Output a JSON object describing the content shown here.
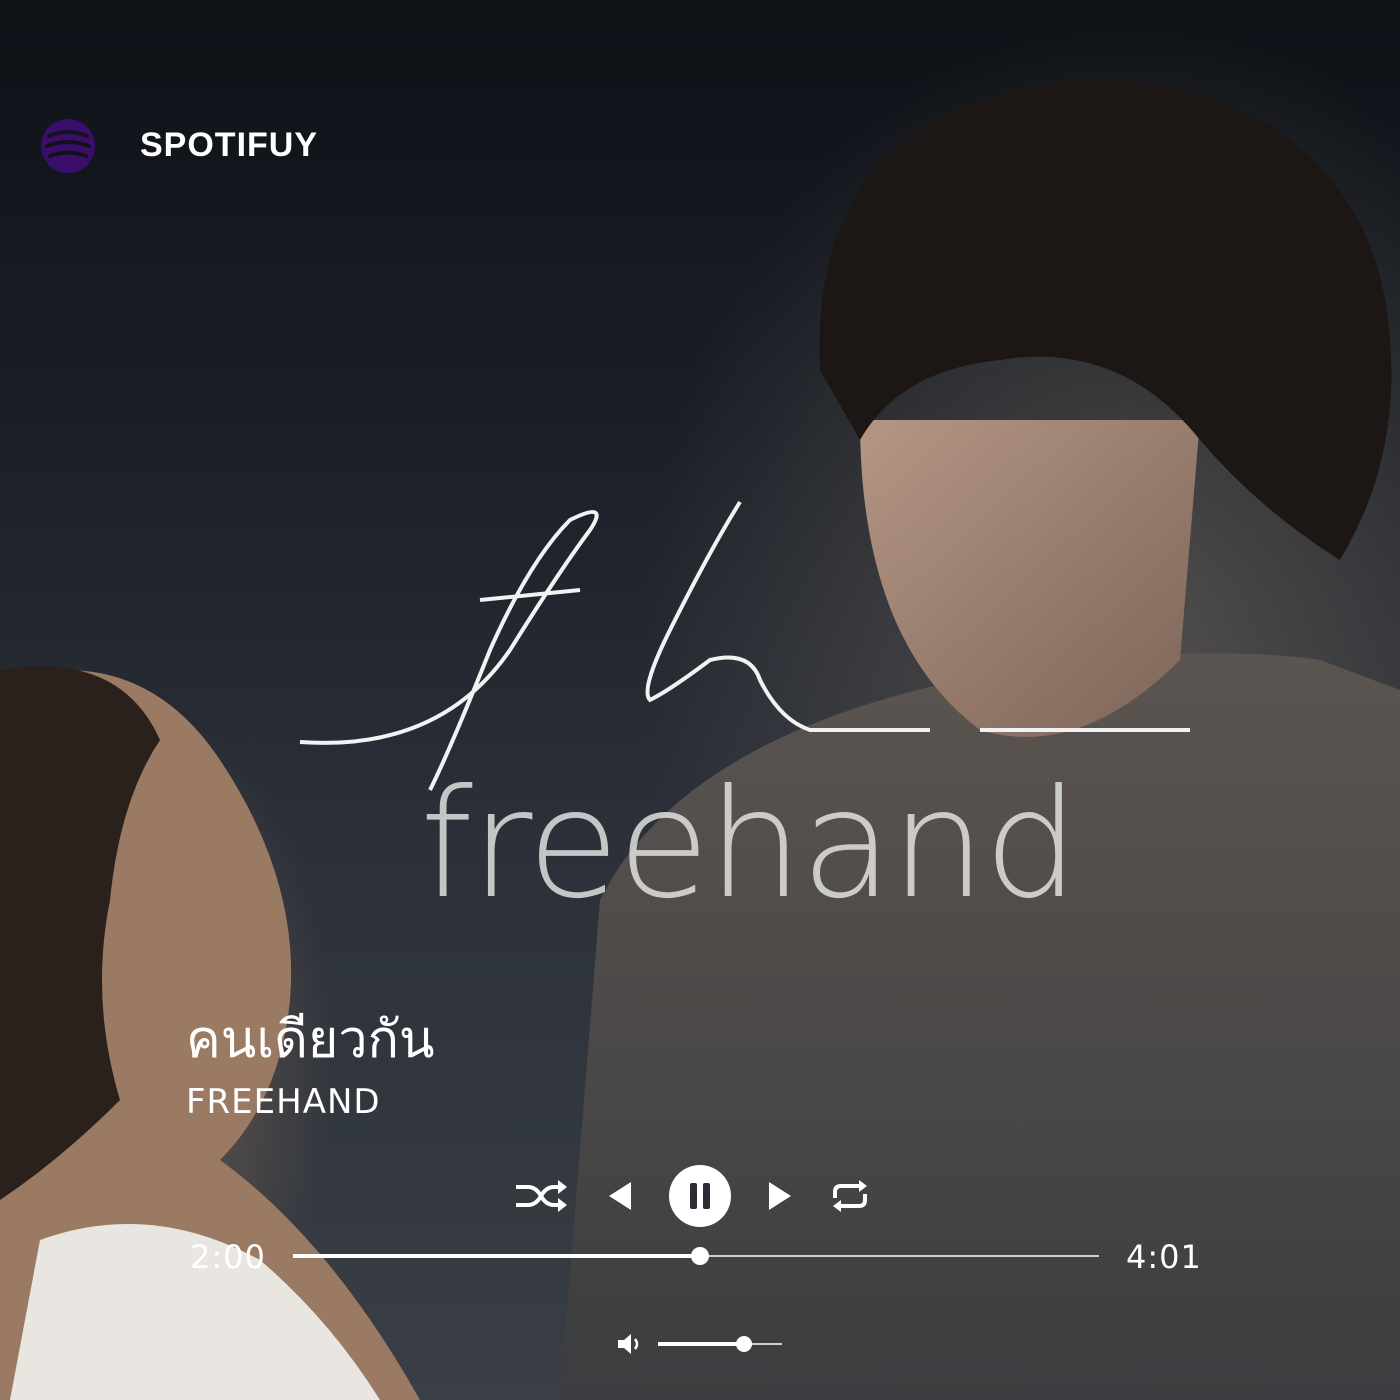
{
  "app": {
    "name": "SPOTIFUY",
    "brand_color": "#3a0f6b"
  },
  "artwork": {
    "logo_text": "freehand"
  },
  "track": {
    "title": "คนเดียวกัน",
    "artist": "FREEHAND"
  },
  "player": {
    "elapsed": "2:00",
    "total": "4:01",
    "progress_fraction": 0.505,
    "state": "playing",
    "controls": [
      "shuffle-icon",
      "previous-icon",
      "pause-icon",
      "next-icon",
      "repeat-icon"
    ]
  },
  "volume": {
    "icon": "volume-icon",
    "level_fraction": 0.69
  }
}
